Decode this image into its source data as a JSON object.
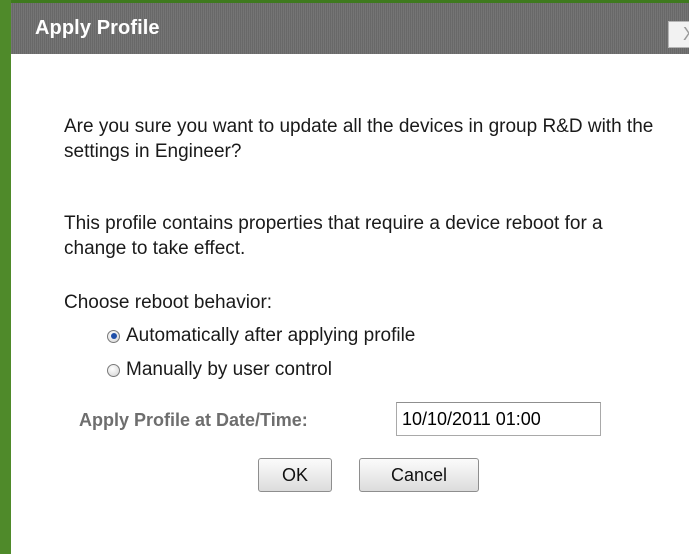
{
  "dialog": {
    "title": "Apply Profile",
    "close_label": "X",
    "message_1": "Are you sure you want to update all the devices in group R&D with the settings in Engineer?",
    "message_2": "This profile contains properties that require a device reboot for a change to take effect.",
    "reboot_prompt": "Choose reboot behavior:",
    "reboot_options": [
      {
        "label": "Automatically after applying profile",
        "selected": true
      },
      {
        "label": "Manually by user control",
        "selected": false
      }
    ],
    "datetime_label": "Apply Profile at Date/Time:",
    "datetime_value": "10/10/2011 01:00",
    "ok_label": "OK",
    "cancel_label": "Cancel"
  },
  "colors": {
    "title_bar": "#6c6c6c",
    "accent_border": "#4f8a2a",
    "radio_selected": "#1f4fa8"
  }
}
